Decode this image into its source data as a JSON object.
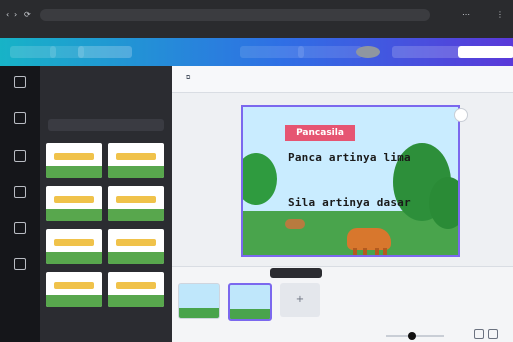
{
  "browser": {
    "nav_icons": [
      "back-icon",
      "forward-icon",
      "reload-icon"
    ],
    "bookmarks": ""
  },
  "topbar": {
    "home": "",
    "file": "",
    "resize": "",
    "undo": "",
    "doc_title": "",
    "share_info": "",
    "avatar": "",
    "stats": "",
    "download": "",
    "share": ""
  },
  "left_rail": {
    "items": [
      "",
      "",
      "",
      "",
      "",
      ""
    ]
  },
  "panel": {
    "title": "",
    "button": ""
  },
  "canvas": {
    "toolbar_left": "",
    "toolbar_right": ""
  },
  "slide": {
    "ribbon": "Pancasila",
    "line1": "Panca artinya lima",
    "line2": "Sila artinya dasar",
    "sky_color": "#c9ecff",
    "ground_color": "#49a44c",
    "ribbon_color": "#e65572"
  },
  "bottom": {
    "tooltip": "",
    "status_left": "",
    "zoom": "",
    "zoom_level": 0.45
  },
  "colors": {
    "topbar_start": "#17b3c7",
    "topbar_mid": "#2f6fe5",
    "topbar_end": "#5a39d9",
    "selection": "#7b68ee"
  }
}
